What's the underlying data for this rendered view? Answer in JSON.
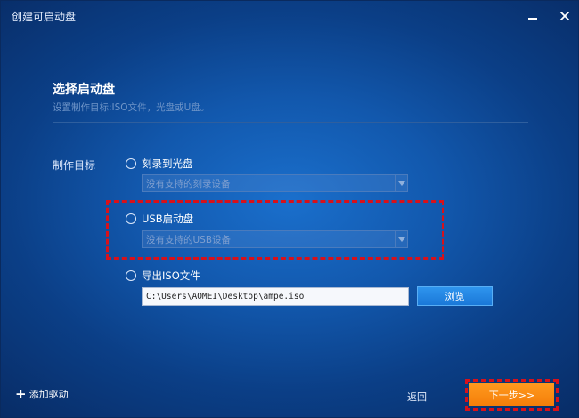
{
  "window": {
    "title": "创建可启动盘"
  },
  "section": {
    "title": "选择启动盘",
    "subtitle": "设置制作目标:ISO文件，光盘或U盘。"
  },
  "target_label": "制作目标",
  "options": {
    "cd": {
      "label": "刻录到光盘",
      "select_value": "没有支持的刻录设备",
      "selected": false
    },
    "usb": {
      "label": "USB启动盘",
      "select_value": "没有支持的USB设备",
      "selected": false
    },
    "iso": {
      "label": "导出ISO文件",
      "path": "C:\\Users\\AOMEI\\Desktop\\ampe.iso",
      "browse_label": "浏览",
      "selected": false
    }
  },
  "footer": {
    "add_driver_icon": "+",
    "add_driver_label": "添加驱动",
    "back_label": "返回",
    "next_label": "下一步>>"
  },
  "colors": {
    "accent_orange": "#f47d09",
    "browse_blue": "#1a78d8",
    "highlight_red": "#d8111a"
  }
}
